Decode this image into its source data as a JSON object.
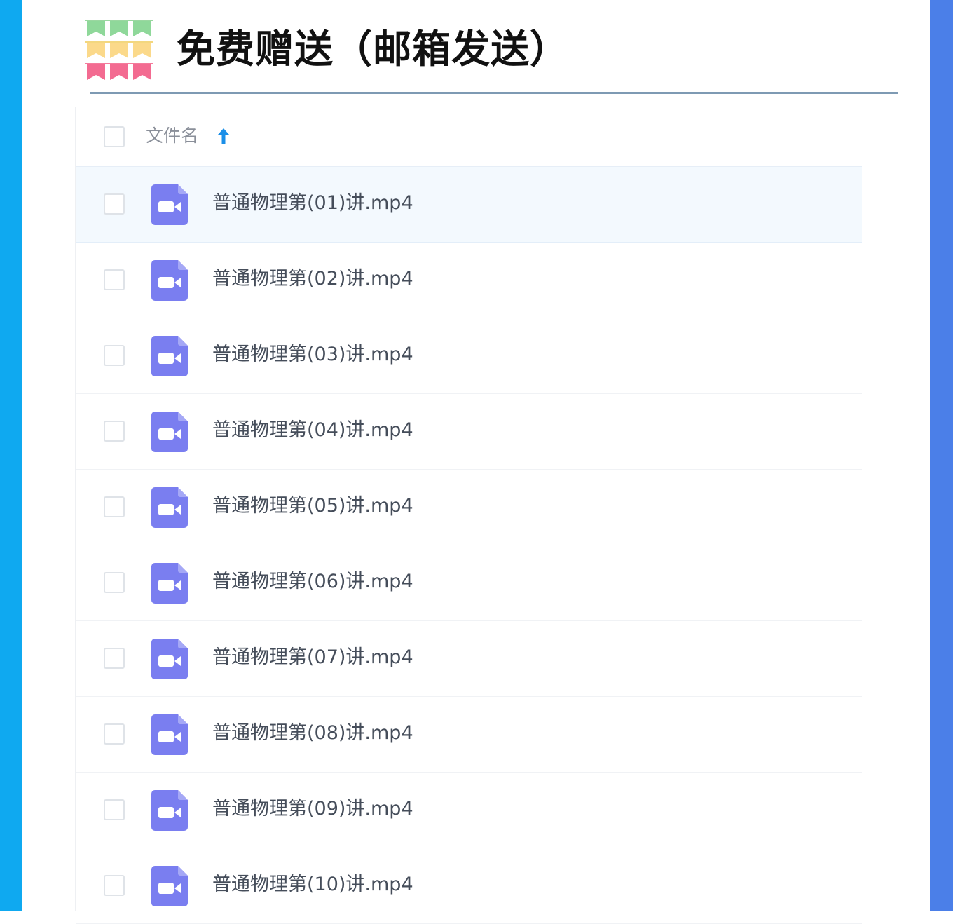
{
  "colors": {
    "left_bar": "#0fa9f0",
    "right_bar": "#4b7fe8",
    "file_icon": "#7a7ef0",
    "sort_arrow": "#1b8fe8",
    "title_rule": "#7e9ab3"
  },
  "header": {
    "title": "免费赠送（邮箱发送）",
    "decoration": "bunting-flags-icon"
  },
  "file_list": {
    "column_header": "文件名",
    "sort_icon": "arrow-up-icon",
    "selected_row": 0,
    "files": [
      {
        "name": "普通物理第(01)讲.mp4",
        "icon": "video-file-icon"
      },
      {
        "name": "普通物理第(02)讲.mp4",
        "icon": "video-file-icon"
      },
      {
        "name": "普通物理第(03)讲.mp4",
        "icon": "video-file-icon"
      },
      {
        "name": "普通物理第(04)讲.mp4",
        "icon": "video-file-icon"
      },
      {
        "name": "普通物理第(05)讲.mp4",
        "icon": "video-file-icon"
      },
      {
        "name": "普通物理第(06)讲.mp4",
        "icon": "video-file-icon"
      },
      {
        "name": "普通物理第(07)讲.mp4",
        "icon": "video-file-icon"
      },
      {
        "name": "普通物理第(08)讲.mp4",
        "icon": "video-file-icon"
      },
      {
        "name": "普通物理第(09)讲.mp4",
        "icon": "video-file-icon"
      },
      {
        "name": "普通物理第(10)讲.mp4",
        "icon": "video-file-icon"
      }
    ]
  }
}
